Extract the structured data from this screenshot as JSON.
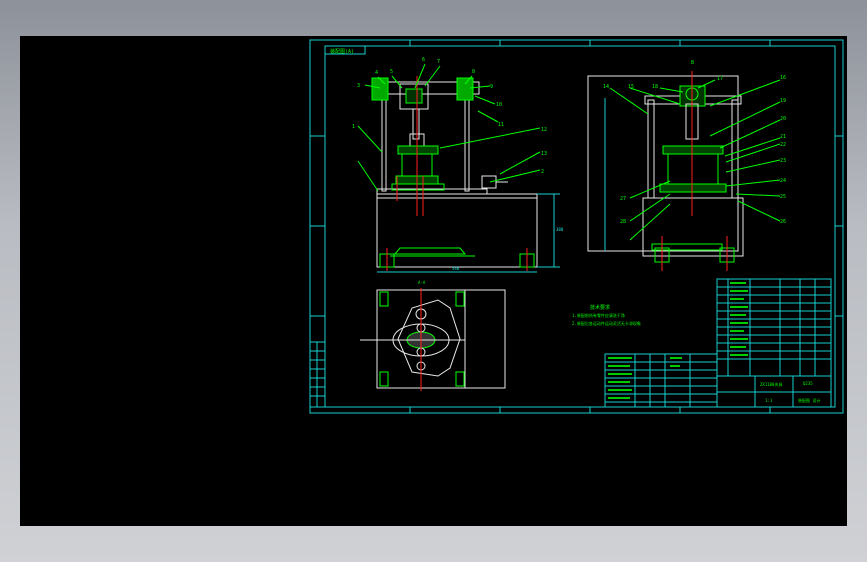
{
  "app": {
    "view_background": "#000000",
    "frame_color": "#19d0d0",
    "part_color": "#e8e8e8",
    "leader_color": "#00ff00",
    "center_color": "#ff2020"
  },
  "sheet": {
    "corner_tag": "装配图(A)",
    "front_view_callouts": [
      "3",
      "4",
      "5",
      "6",
      "7",
      "8",
      "9",
      "10",
      "11",
      "12",
      "13",
      "2",
      "1"
    ],
    "side_view_callouts": [
      "14",
      "15",
      "16",
      "17",
      "18",
      "19",
      "20",
      "21",
      "22",
      "23",
      "24",
      "25",
      "26",
      "27",
      "28"
    ],
    "plan_label": "A-A",
    "side_view_label": "B",
    "tech_req_title": "技术要求",
    "tech_req_line1": "1.装配前所有零件应清洗干净",
    "tech_req_line2": "2.装配后各运动件运动灵活无卡滞现象",
    "dim_height": "380",
    "dim_width": "546",
    "title_drawing_name": "ZX1100夹具",
    "title_material": "Q235",
    "title_scale": "1:1",
    "title_school": "装配图 设计"
  }
}
